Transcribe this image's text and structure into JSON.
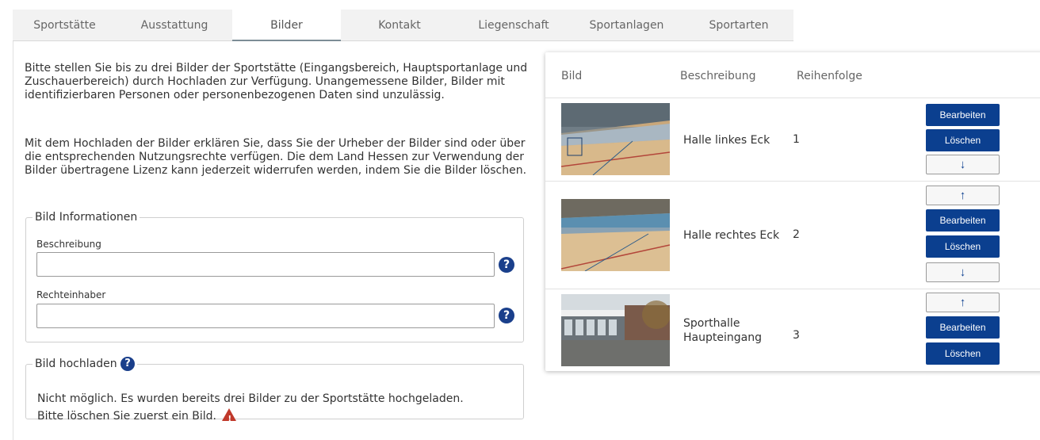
{
  "tabs": [
    {
      "label": "Sportstätte"
    },
    {
      "label": "Ausstattung"
    },
    {
      "label": "Bilder"
    },
    {
      "label": "Kontakt"
    },
    {
      "label": "Liegenschaft"
    },
    {
      "label": "Sportanlagen"
    },
    {
      "label": "Sportarten"
    }
  ],
  "active_tab": "Bilder",
  "intro": {
    "paragraph1": "Bitte stellen Sie bis zu drei Bilder der Sportstätte (Eingangsbereich, Hauptsportanlage und Zuschauerbereich) durch Hochladen zur Verfügung. Unangemessene Bilder, Bilder mit identifizierbaren Personen oder personenbezogenen Daten sind unzulässig.",
    "paragraph2": "Mit dem Hochladen der Bilder erklären Sie, dass Sie der Urheber der Bilder sind oder über die entsprechenden Nutzungsrechte verfügen. Die dem Land Hessen zur Verwendung der Bilder übertragene Lizenz kann jederzeit widerrufen werden, indem Sie die Bilder löschen."
  },
  "info_box": {
    "legend": "Bild Informationen",
    "beschreibung_label": "Beschreibung",
    "beschreibung_value": "",
    "rechteinhaber_label": "Rechteinhaber",
    "rechteinhaber_value": "",
    "help_glyph": "?"
  },
  "upload_box": {
    "legend": "Bild hochladen",
    "help_glyph": "?",
    "message": "Nicht möglich. Es wurden bereits drei Bilder zu der Sportstätte hochgeladen. Bitte löschen Sie zuerst ein Bild.",
    "warning_icon": "warning-triangle-icon"
  },
  "table": {
    "headers": {
      "bild": "Bild",
      "beschreibung": "Beschreibung",
      "reihenfolge": "Reihenfolge"
    },
    "rows": [
      {
        "beschreibung": "Halle linkes Eck",
        "reihenfolge": "1",
        "image": "sports-hall-left-corner"
      },
      {
        "beschreibung": "Halle rechtes Eck",
        "reihenfolge": "2",
        "image": "sports-hall-right-corner"
      },
      {
        "beschreibung": "Sporthalle Haupteingang",
        "reihenfolge": "3",
        "image": "sports-hall-entrance"
      }
    ],
    "buttons": {
      "edit": "Bearbeiten",
      "delete": "Löschen",
      "up": "↑",
      "down": "↓"
    }
  },
  "colors": {
    "primary": "#0b3f8f",
    "help_icon": "#1a3f8b",
    "warning": "#c0392b",
    "tab_bar": "#f2f2f2"
  }
}
